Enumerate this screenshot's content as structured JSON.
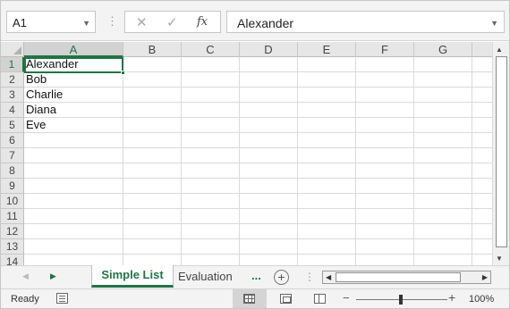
{
  "formula_bar": {
    "name_box": "A1",
    "cancel_icon": "✕",
    "enter_icon": "✓",
    "function_icon": "fx",
    "formula_value": "Alexander"
  },
  "grid": {
    "columns": [
      "A",
      "B",
      "C",
      "D",
      "E",
      "F",
      "G"
    ],
    "rows": [
      "1",
      "2",
      "3",
      "4",
      "5",
      "6",
      "7",
      "8",
      "9",
      "10",
      "11",
      "12",
      "13",
      "14"
    ],
    "cells": [
      "Alexander",
      "Bob",
      "Charlie",
      "Diana",
      "Eve"
    ],
    "selected_cell": "A1"
  },
  "sheet_tabs": {
    "active": "Simple List",
    "other": "Evaluation",
    "more": "...",
    "add": "+"
  },
  "status_bar": {
    "ready": "Ready",
    "zoom_minus": "−",
    "zoom_plus": "+",
    "zoom": "100%"
  },
  "colors": {
    "accent": "#217346",
    "header_bg": "#e6e6e6",
    "gridline": "#dadada"
  }
}
